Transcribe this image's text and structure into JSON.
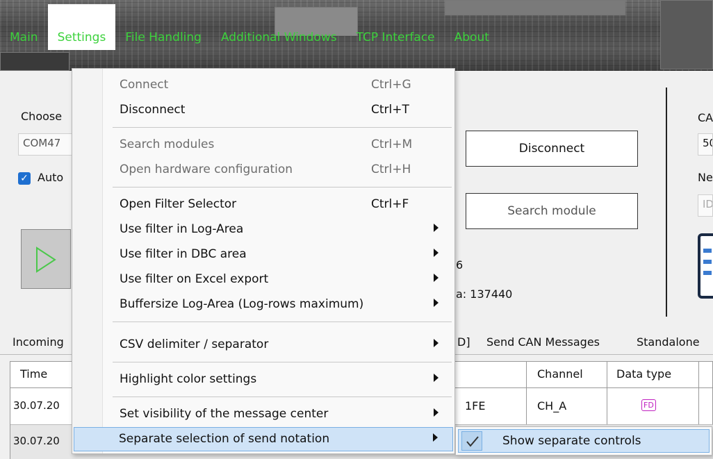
{
  "menubar": {
    "items": [
      "Main",
      "Settings",
      "File Handling",
      "Additional Windows",
      "TCP Interface",
      "About"
    ]
  },
  "main": {
    "choose_label": "Choose",
    "com_port_value": "COM47",
    "auto_label": "Auto",
    "disconnect_button": "Disconnect",
    "search_module_button": "Search module",
    "info_line1": "6",
    "info_line2": "a: 137440",
    "right_label_1": "CA",
    "right_field_1": "50",
    "right_label_2": "Ne",
    "right_field_2": "ID"
  },
  "tabs": [
    "Incoming",
    "D]",
    "Send CAN Messages",
    "Standalone"
  ],
  "grid": {
    "headers": [
      "Time",
      "Channel",
      "Data type"
    ],
    "rows": [
      {
        "time": "30.07.20",
        "id": "1FE",
        "channel": "CH_A",
        "data_type": "FD"
      },
      {
        "time": "30.07.20"
      }
    ]
  },
  "settings_menu": {
    "items": [
      {
        "label": "Connect",
        "shortcut": "Ctrl+G",
        "disabled": true
      },
      {
        "label": "Disconnect",
        "shortcut": "Ctrl+T"
      },
      {
        "label": "Search modules",
        "shortcut": "Ctrl+M",
        "disabled": true
      },
      {
        "label": "Open hardware configuration",
        "shortcut": "Ctrl+H",
        "disabled": true
      },
      {
        "label": "Open Filter Selector",
        "shortcut": "Ctrl+F"
      },
      {
        "label": "Use filter in Log-Area",
        "submenu": true
      },
      {
        "label": "Use filter in DBC area",
        "submenu": true
      },
      {
        "label": "Use filter on Excel export",
        "submenu": true
      },
      {
        "label": "Buffersize Log-Area (Log-rows maximum)",
        "submenu": true
      },
      {
        "label": "CSV delimiter / separator",
        "submenu": true
      },
      {
        "label": "Highlight color settings",
        "submenu": true
      },
      {
        "label": "Set visibility of the message center",
        "submenu": true
      },
      {
        "label": "Separate selection of send notation",
        "submenu": true,
        "highlighted": true
      }
    ]
  },
  "submenu": {
    "item_label": "Show separate controls",
    "checked": true
  },
  "colors": {
    "menu_text": "#3cd23c",
    "highlight_bg": "#cfe3f7",
    "highlight_border": "#7ab0e4",
    "checkbox": "#1e6fd0",
    "fd_badge": "#c020c0"
  }
}
